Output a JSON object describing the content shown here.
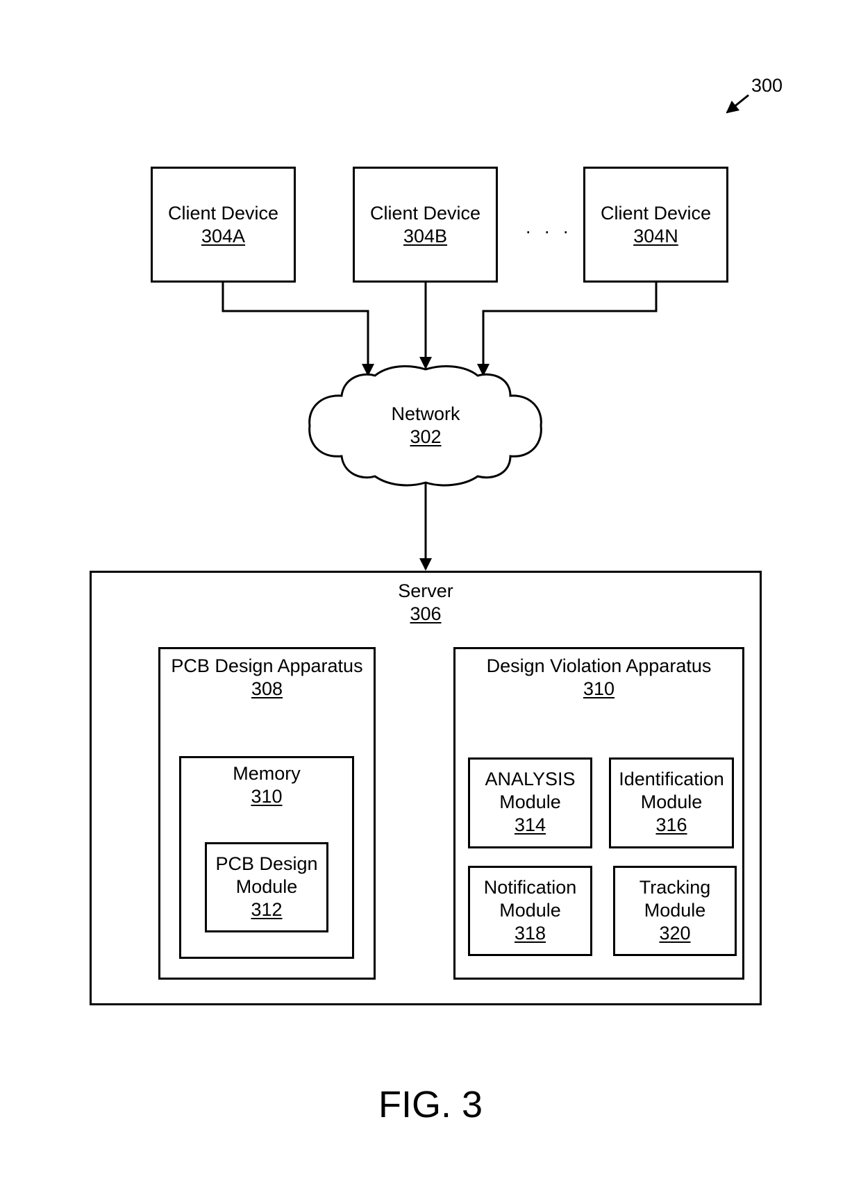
{
  "figure": {
    "reference": "300",
    "caption": "FIG. 3"
  },
  "clients": [
    {
      "title": "Client Device",
      "ref": "304A"
    },
    {
      "title": "Client Device",
      "ref": "304B"
    },
    {
      "title": "Client Device",
      "ref": "304N"
    }
  ],
  "ellipsis": ". . .",
  "network": {
    "title": "Network",
    "ref": "302"
  },
  "server": {
    "title": "Server",
    "ref": "306"
  },
  "pcb_apparatus": {
    "title": "PCB Design Apparatus",
    "ref": "308",
    "memory": {
      "title": "Memory",
      "ref": "310",
      "module": {
        "line1": "PCB Design",
        "line2": "Module",
        "ref": "312"
      }
    }
  },
  "violation_apparatus": {
    "title": "Design Violation Apparatus",
    "ref": "310",
    "modules": [
      {
        "line1": "ANALYSIS",
        "line2": "Module",
        "ref": "314"
      },
      {
        "line1": "Identification",
        "line2": "Module",
        "ref": "316"
      },
      {
        "line1": "Notification",
        "line2": "Module",
        "ref": "318"
      },
      {
        "line1": "Tracking",
        "line2": "Module",
        "ref": "320"
      }
    ]
  },
  "colors": {
    "stroke": "#000000",
    "background": "#ffffff"
  }
}
